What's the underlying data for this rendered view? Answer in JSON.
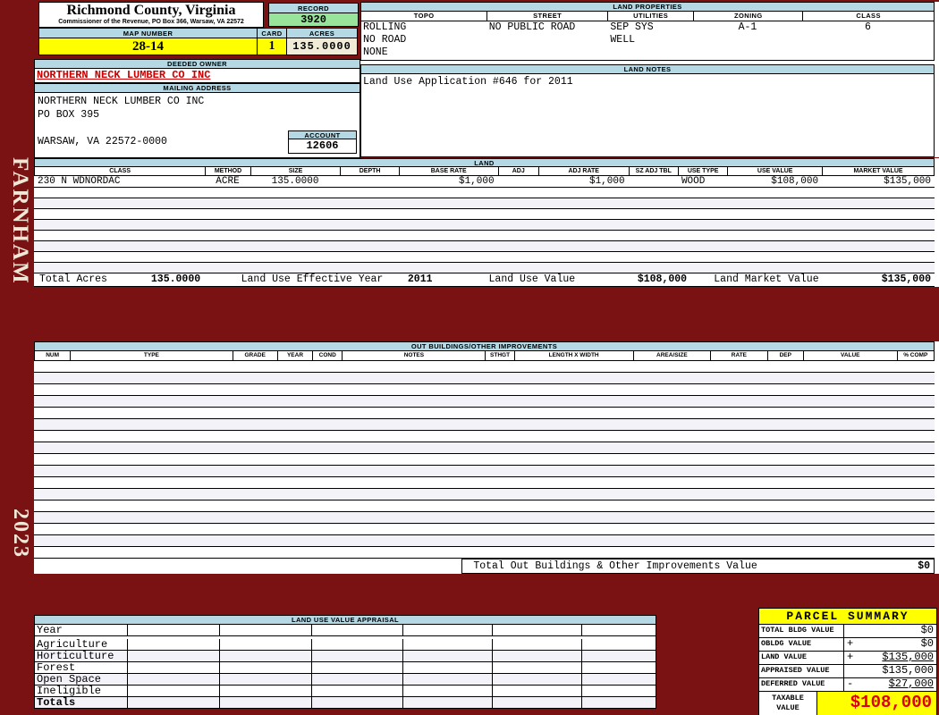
{
  "colors": {
    "page_maroon": "#7a1113",
    "header_blue": "#b4d8e4",
    "highlight_yellow": "#ffff00",
    "record_green": "#98e49a",
    "acres_cream": "#f0ecd8",
    "owner_red": "#cc0000",
    "taxable_red": "#dd0000"
  },
  "sidebar": {
    "district": "FARNHAM",
    "year": "2023"
  },
  "header": {
    "county": "Richmond County, Virginia",
    "address_line": "Commissioner of the Revenue, PO Box 366, Warsaw, VA 22572",
    "record_label": "RECORD",
    "record_value": "3920",
    "map_number_label": "MAP NUMBER",
    "map_number": "28-14",
    "card_label": "CARD",
    "card": "1",
    "acres_label": "ACRES",
    "acres": "135.0000"
  },
  "land_properties": {
    "title": "LAND PROPERTIES",
    "columns": [
      "TOPO",
      "STREET",
      "UTILITIES",
      "ZONING",
      "CLASS"
    ],
    "topo": [
      "ROLLING",
      "NO ROAD",
      "NONE"
    ],
    "street": [
      "NO PUBLIC ROAD"
    ],
    "utilities": [
      "SEP SYS",
      "WELL"
    ],
    "zoning": "A-1",
    "class": "6"
  },
  "owner": {
    "deeded_owner_label": "DEEDED OWNER",
    "deeded_owner": "NORTHERN NECK LUMBER CO INC",
    "mailing_address_label": "MAILING ADDRESS",
    "mailing_lines": [
      "NORTHERN NECK LUMBER CO INC",
      "PO BOX 395",
      "",
      "WARSAW, VA 22572-0000"
    ],
    "account_label": "ACCOUNT",
    "account": "12606"
  },
  "land_notes": {
    "title": "LAND NOTES",
    "note": "Land Use Application #646 for 2011"
  },
  "land": {
    "title": "LAND",
    "columns": [
      "CLASS",
      "METHOD",
      "SIZE",
      "DEPTH",
      "BASE RATE",
      "ADJ",
      "ADJ RATE",
      "SZ ADJ TBL",
      "USE TYPE",
      "USE VALUE",
      "MARKET VALUE"
    ],
    "row": {
      "class": "230 N WDNORDAC",
      "method": "ACRE",
      "size": "135.0000",
      "depth": "",
      "base_rate": "$1,000",
      "adj": "",
      "adj_rate": "$1,000",
      "sz_adj_tbl": "",
      "use_type": "WOOD",
      "use_value": "$108,000",
      "market_value": "$135,000"
    },
    "empty_row_count": 8,
    "totals": {
      "total_acres_label": "Total Acres",
      "total_acres": "135.0000",
      "effective_year_label": "Land Use Effective Year",
      "effective_year": "2011",
      "use_value_label": "Land Use Value",
      "use_value": "$108,000",
      "market_value_label": "Land Market Value",
      "market_value": "$135,000"
    }
  },
  "out_buildings": {
    "title": "OUT BUILDINGS/OTHER IMPROVEMENTS",
    "columns": [
      "NUM",
      "TYPE",
      "GRADE",
      "YEAR",
      "COND",
      "NOTES",
      "STHGT",
      "LENGTH X WIDTH",
      "AREA/SIZE",
      "RATE",
      "DEP",
      "VALUE",
      "% COMP"
    ],
    "empty_row_count": 17,
    "total_label": "Total Out Buildings & Other Improvements Value",
    "total_value": "$0"
  },
  "land_use_appraisal": {
    "title": "LAND USE VALUE APPRAISAL",
    "row_labels": [
      "Year",
      "Agriculture",
      "Horticulture",
      "Forest",
      "Open Space",
      "Ineligible",
      "Totals"
    ]
  },
  "parcel_summary": {
    "title": "PARCEL SUMMARY",
    "rows": [
      {
        "label": "TOTAL BLDG VALUE",
        "op": "",
        "value": "$0"
      },
      {
        "label": "OBLDG VALUE",
        "op": "+",
        "value": "$0"
      },
      {
        "label": "LAND VALUE",
        "op": "+",
        "value": "$135,000"
      },
      {
        "label": "APPRAISED VALUE",
        "op": "",
        "value": "$135,000"
      },
      {
        "label": "DEFERRED VALUE",
        "op": "-",
        "value": "$27,000"
      }
    ],
    "taxable_label_line1": "TAXABLE",
    "taxable_label_line2": "VALUE",
    "taxable_value": "$108,000"
  }
}
